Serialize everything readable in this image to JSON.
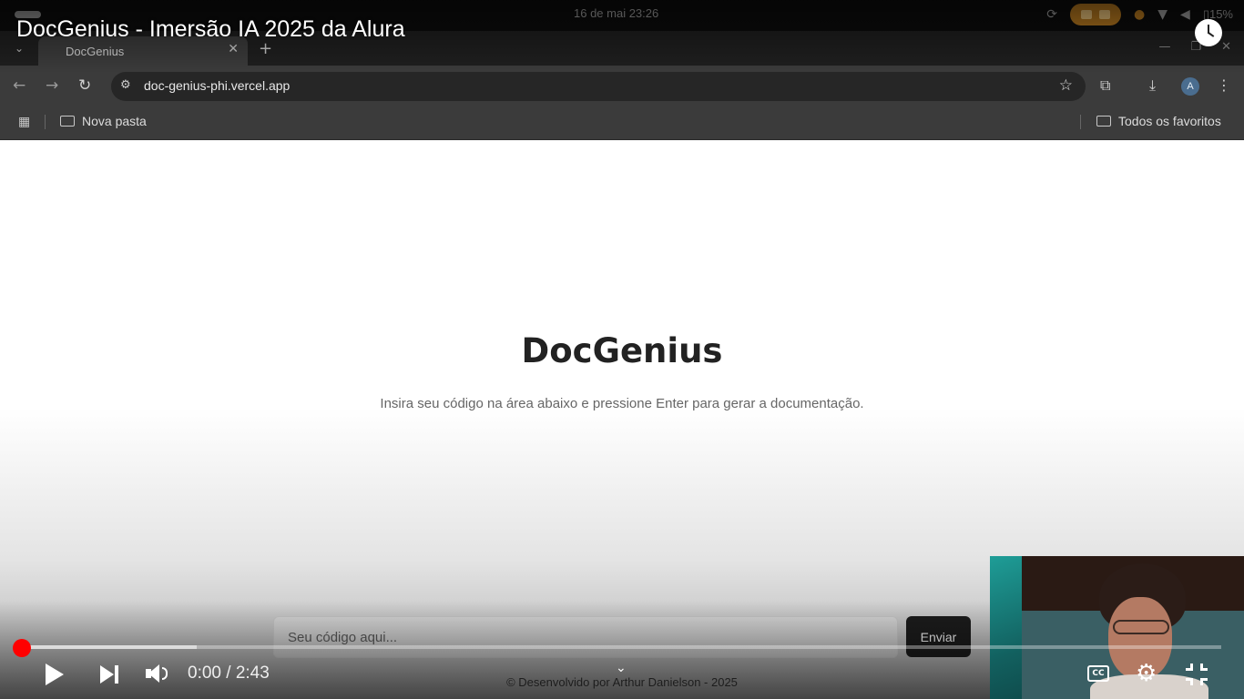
{
  "os_bar": {
    "date_time": "16 de mai  23:26",
    "battery": "15%"
  },
  "browser": {
    "tab_title": "DocGenius",
    "url": "doc-genius-phi.vercel.app",
    "profile_initial": "A",
    "bookmarks": {
      "folder": "Nova pasta",
      "all_favorites": "Todos os favoritos"
    }
  },
  "page": {
    "title": "DocGenius",
    "subtitle": "Insira seu código na área abaixo e pressione Enter para gerar a documentação.",
    "input_placeholder": "Seu código aqui...",
    "send_label": "Enviar",
    "footer": "© Desenvolvido por Arthur Danielson - 2025"
  },
  "player": {
    "video_title": "DocGenius - Imersão IA 2025 da Alura",
    "time": "0:00 / 2:43",
    "played_fraction": 0.0,
    "buffered_fraction": 0.146,
    "cc_label": "CC",
    "icons": {
      "play": "play-icon",
      "next": "next-icon",
      "volume": "volume-icon",
      "settings": "gear-icon",
      "exit_fullscreen": "exit-fullscreen-icon",
      "watch_later": "clock-icon"
    },
    "accent_color": "#ff0000"
  }
}
